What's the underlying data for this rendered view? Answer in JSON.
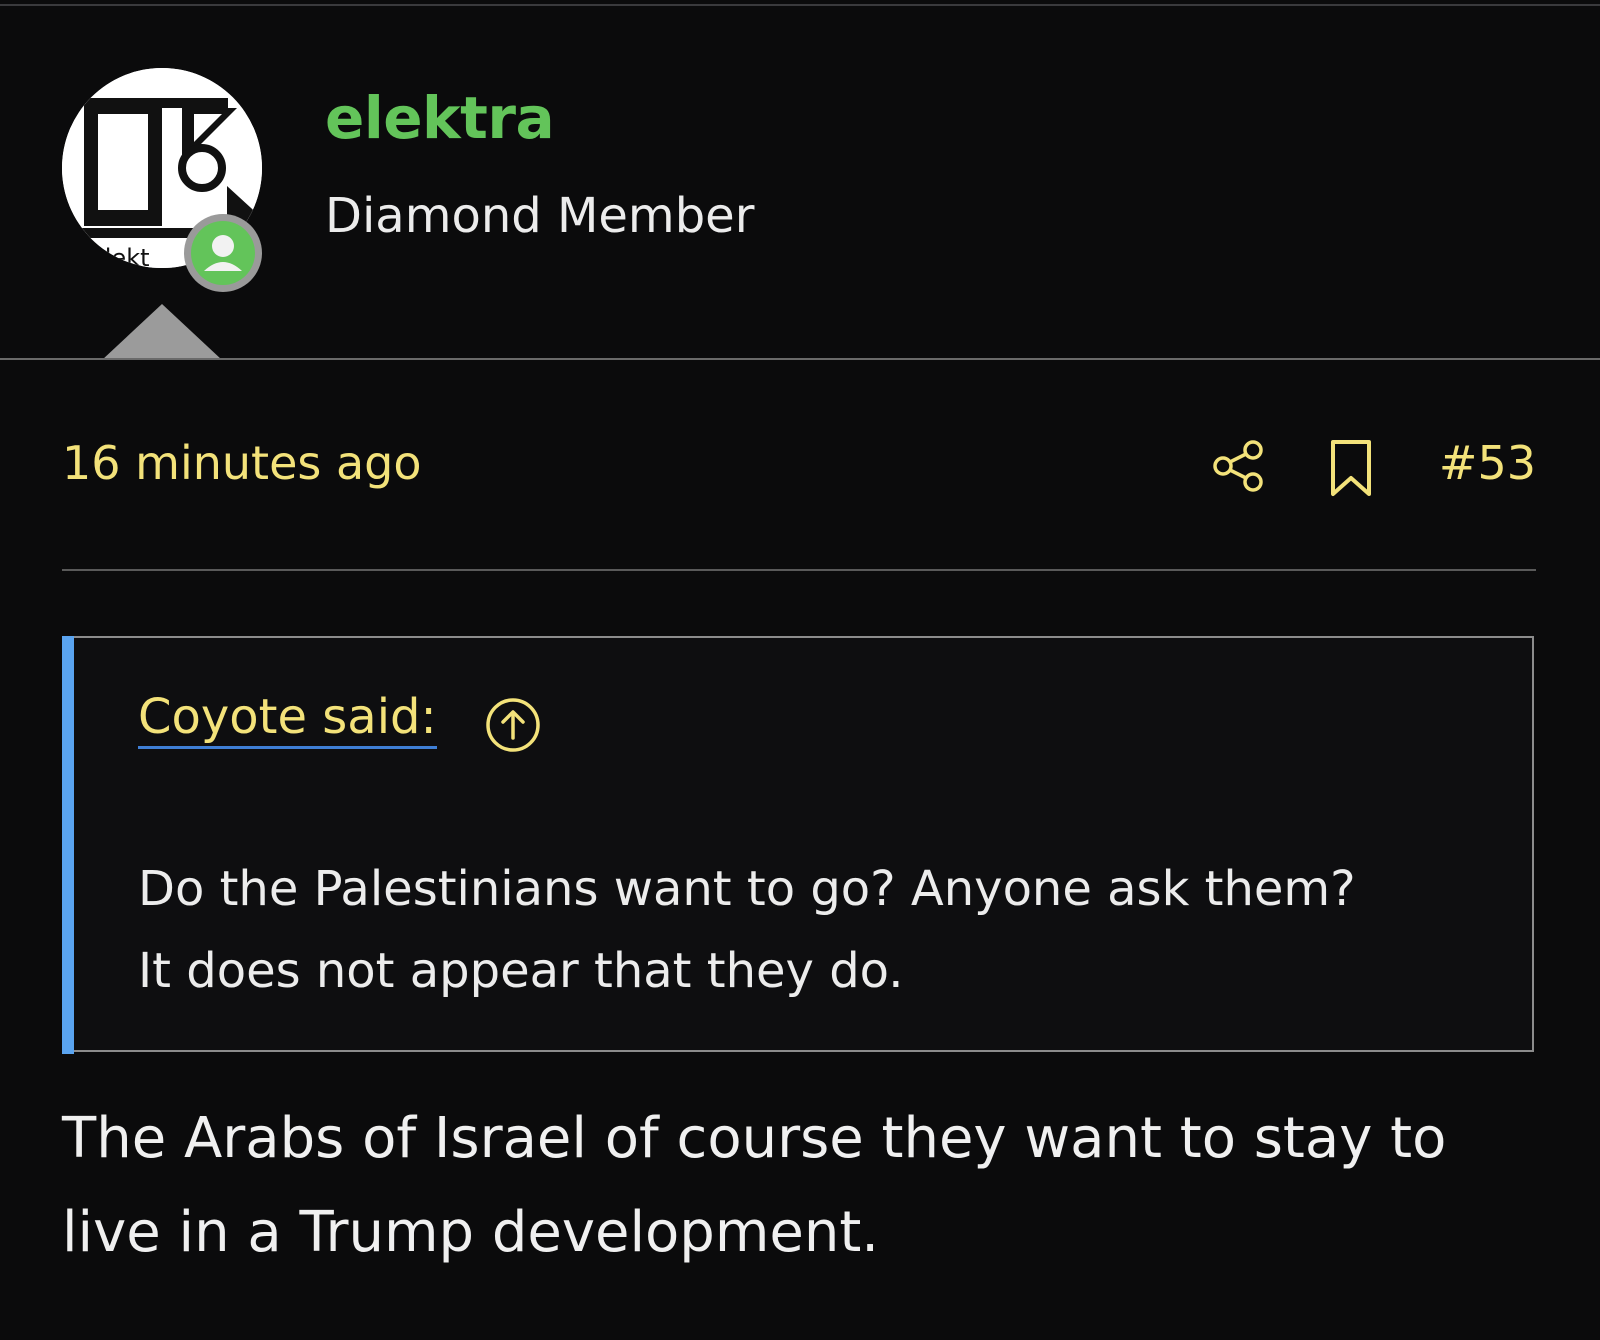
{
  "user": {
    "name": "elektra",
    "title": "Diamond Member",
    "avatar_icon": "avatar-logo",
    "online_icon": "online-user-icon",
    "name_color": "#63c45a"
  },
  "post": {
    "time": "16 minutes ago",
    "number": "#53",
    "share_icon": "share-icon",
    "bookmark_icon": "bookmark-icon",
    "meta_color": "#f3e27a"
  },
  "quote": {
    "author": "Coyote said:",
    "jump_icon": "arrow-up-circle-icon",
    "lines": [
      "Do the Palestinians want to go? Anyone ask them?",
      "It does not appear that they do."
    ],
    "bar_color": "#5aa4f0"
  },
  "reply": {
    "lines": [
      "The Arabs of Israel of course they want to stay to",
      "live in a Trump development."
    ]
  }
}
